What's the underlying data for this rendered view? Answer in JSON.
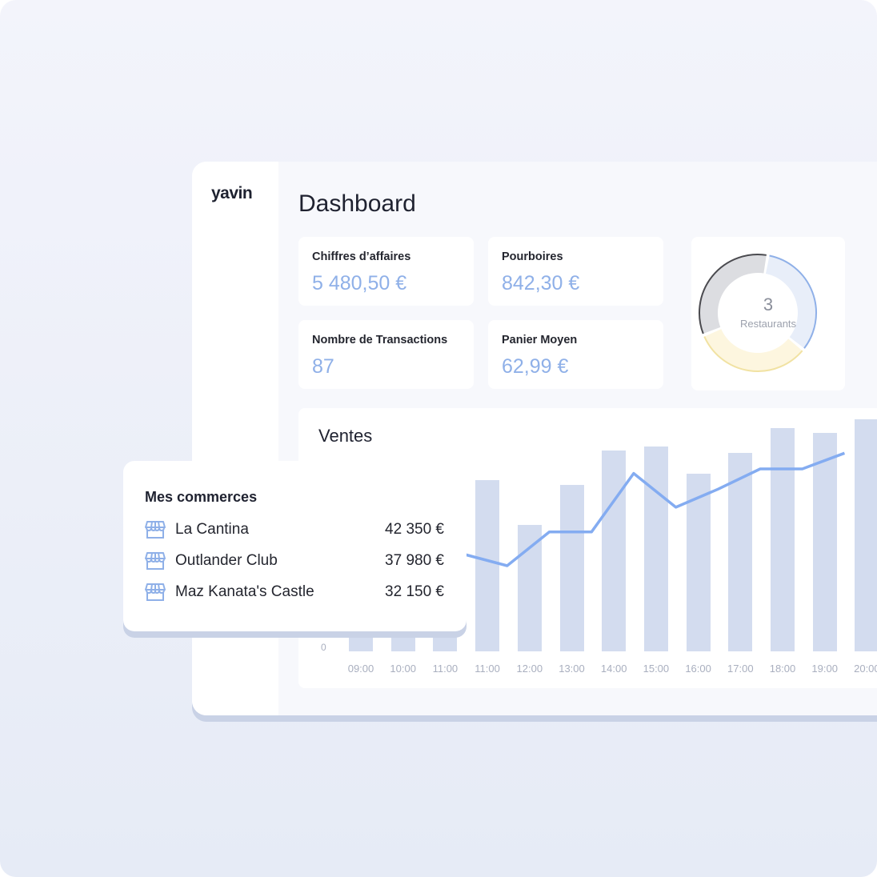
{
  "app": {
    "logo": "yavin"
  },
  "dashboard": {
    "title": "Dashboard",
    "kpis": [
      {
        "label": "Chiffres d’affaires",
        "value": "5 480,50 €"
      },
      {
        "label": "Pourboires",
        "value": "842,30 €"
      },
      {
        "label": "Nombre de Transactions",
        "value": "87"
      },
      {
        "label": "Panier Moyen",
        "value": "62,99 €"
      }
    ],
    "restaurants": {
      "count": "3",
      "label": "Restaurants"
    }
  },
  "sales": {
    "title": "Ventes",
    "zero_label": "0"
  },
  "stores": {
    "title": "Mes commerces",
    "items": [
      {
        "name": "La Cantina",
        "amount": "42 350 €"
      },
      {
        "name": "Outlander Club",
        "amount": "37 980 €"
      },
      {
        "name": "Maz Kanata's Castle",
        "amount": "32 150 €"
      }
    ]
  },
  "colors": {
    "accent": "#8fb0e8",
    "line": "#84acf1",
    "bar": "#d3dcef",
    "donut_blue": "#8fb0e8",
    "donut_yellow": "#f1e2a2",
    "donut_dark": "#4a4a4f"
  },
  "chart_data": {
    "type": "bar",
    "categories": [
      "09:00",
      "10:00",
      "11:00",
      "11:00",
      "12:00",
      "13:00",
      "14:00",
      "15:00",
      "16:00",
      "17:00",
      "18:00",
      "19:00",
      "20:00"
    ],
    "series": [
      {
        "values": [
          420,
          440,
          470,
          760,
          560,
          740,
          890,
          910,
          790,
          880,
          990,
          970,
          1030
        ]
      },
      {
        "values": [
          null,
          null,
          null,
          430,
          380,
          530,
          530,
          790,
          640,
          720,
          810,
          810,
          880
        ]
      }
    ],
    "ylim": [
      0,
      1080
    ]
  },
  "donut_data": {
    "type": "pie",
    "values": [
      33,
      33,
      34
    ]
  }
}
